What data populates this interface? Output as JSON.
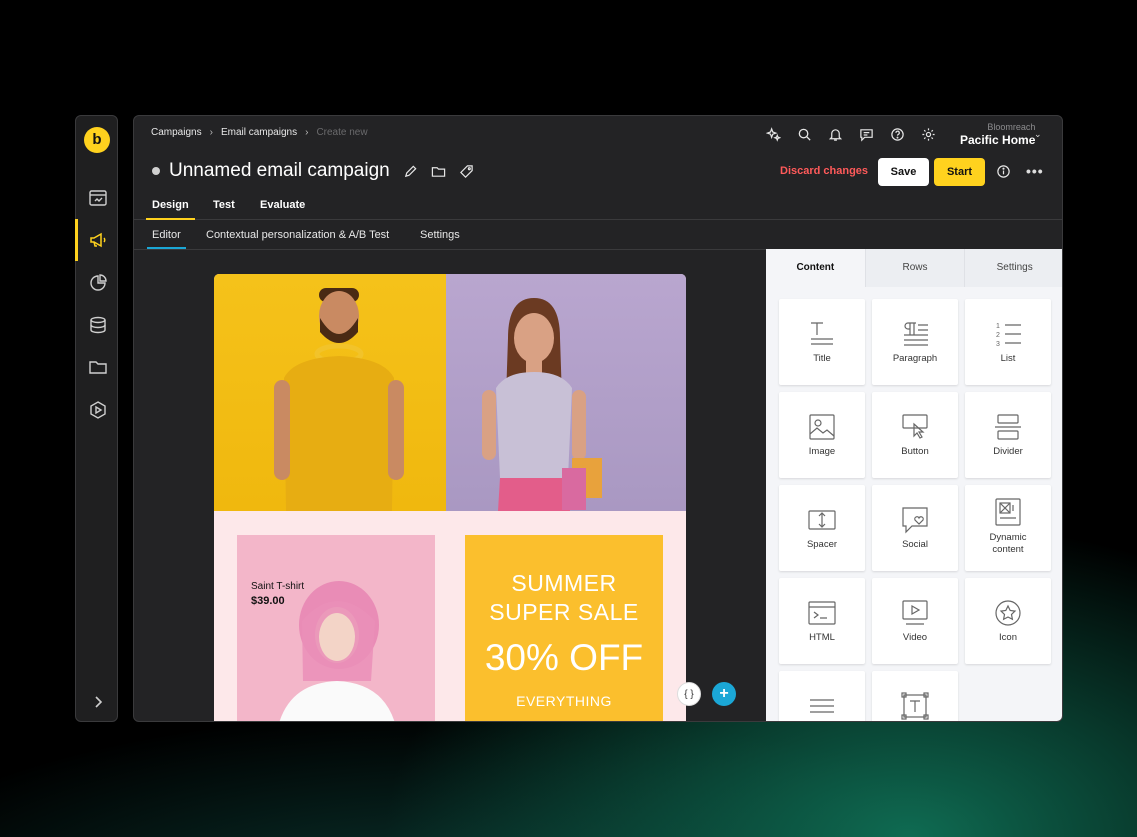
{
  "app": {
    "logo_letter": "b",
    "accent": "#ffd21e",
    "link_accent": "#1ba7d6"
  },
  "sidebar": {
    "items": [
      {
        "icon": "dashboard-icon"
      },
      {
        "icon": "megaphone-icon",
        "active": true
      },
      {
        "icon": "pie-chart-icon"
      },
      {
        "icon": "database-icon"
      },
      {
        "icon": "folder-icon"
      },
      {
        "icon": "play-hexagon-icon"
      }
    ],
    "expand_icon": "chevron-right-icon"
  },
  "breadcrumb": {
    "items": [
      "Campaigns",
      "Email campaigns",
      "Create new"
    ]
  },
  "account": {
    "org": "Bloomreach",
    "project": "Pacific Home"
  },
  "header": {
    "title": "Unnamed email campaign",
    "discard_label": "Discard changes",
    "save_label": "Save",
    "start_label": "Start"
  },
  "tabs_primary": [
    "Design",
    "Test",
    "Evaluate"
  ],
  "tabs_secondary": [
    "Editor",
    "Contextual personalization & A/B Test",
    "Settings"
  ],
  "email": {
    "product_name": "Saint T-shirt",
    "product_price": "$39.00",
    "sale_line1": "SUMMER",
    "sale_line2": "SUPER SALE",
    "sale_discount": "30% OFF",
    "sale_sub": "EVERYTHING",
    "merge_tag_label": "{ }",
    "add_label": "+"
  },
  "panel": {
    "tabs": [
      "Content",
      "Rows",
      "Settings"
    ],
    "blocks": [
      "Title",
      "Paragraph",
      "List",
      "Image",
      "Button",
      "Divider",
      "Spacer",
      "Social",
      "Dynamic content",
      "HTML",
      "Video",
      "Icon"
    ]
  }
}
